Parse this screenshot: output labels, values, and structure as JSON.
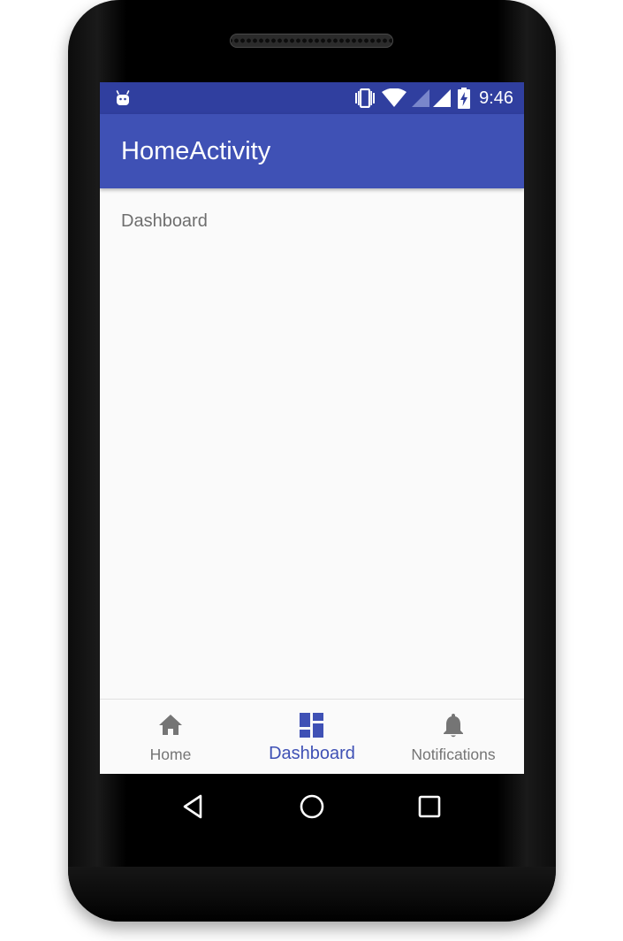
{
  "status_bar": {
    "time": "9:46",
    "left_icon": "android-debug-icon",
    "right_icons": [
      "vibrate-icon",
      "wifi-icon",
      "cell-signal-icon",
      "battery-charging-icon"
    ]
  },
  "app_bar": {
    "title": "HomeActivity"
  },
  "content": {
    "text": "Dashboard"
  },
  "bottom_nav": {
    "items": [
      {
        "label": "Home",
        "icon": "home-icon",
        "active": false
      },
      {
        "label": "Dashboard",
        "icon": "dashboard-icon",
        "active": true
      },
      {
        "label": "Notifications",
        "icon": "bell-icon",
        "active": false
      }
    ]
  },
  "system_nav": {
    "buttons": [
      "back-icon",
      "home-circle-icon",
      "recents-icon"
    ]
  },
  "colors": {
    "primary": "#3f51b5",
    "primary_dark": "#303f9f",
    "inactive": "#757575",
    "background": "#fafafa"
  }
}
